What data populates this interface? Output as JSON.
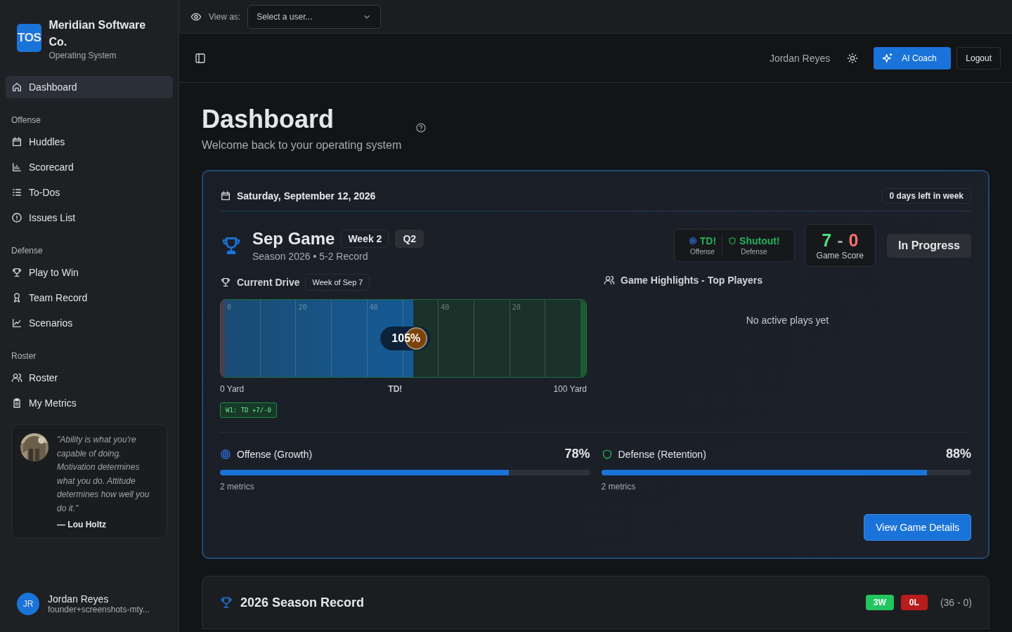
{
  "brand": {
    "logo": "TOS",
    "name": "Meridian Software Co.",
    "tagline": "Operating System"
  },
  "dashboard_item": {
    "label": "Dashboard",
    "selected": true
  },
  "nav_sections": [
    {
      "title": "Offense",
      "items": [
        {
          "label": "Huddles",
          "selected": false
        },
        {
          "label": "Scorecard",
          "selected": false
        },
        {
          "label": "To-Dos",
          "selected": false
        },
        {
          "label": "Issues List",
          "selected": false
        }
      ]
    },
    {
      "title": "Defense",
      "items": [
        {
          "label": "Play to Win",
          "selected": false
        },
        {
          "label": "Team Record",
          "selected": false
        },
        {
          "label": "Scenarios",
          "selected": false
        }
      ]
    },
    {
      "title": "Roster",
      "items": [
        {
          "label": "Roster",
          "selected": false
        },
        {
          "label": "My Metrics",
          "selected": false
        }
      ]
    }
  ],
  "quote": {
    "text": "\"Ability is what you're capable of doing. Motivation determines what you do. Attitude determines how well you do it.\"",
    "author": "— Lou Holtz"
  },
  "user": {
    "initials": "JR",
    "name": "Jordan Reyes",
    "email": "founder+screenshots-mty..."
  },
  "topbar": {
    "view_as_label": "View as:",
    "select_placeholder": "Select a user..."
  },
  "header": {
    "user_name": "Jordan Reyes",
    "ai_button": "AI Coach",
    "logout_button": "Logout"
  },
  "page": {
    "title": "Dashboard",
    "subtitle": "Welcome back to your operating system"
  },
  "game_card": {
    "date": "Saturday, September 12, 2026",
    "days_left": "0 days left in week",
    "title": "Sep Game",
    "week_badge": "Week 2",
    "quarter_badge": "Q2",
    "subtitle": "Season 2026 • 5-2 Record",
    "status_items": [
      {
        "kind": "offense",
        "value": "TD!",
        "label": "Offense"
      },
      {
        "kind": "defense",
        "value": "Shutout!",
        "label": "Defense"
      }
    ],
    "score": {
      "home": "7",
      "separator": "-",
      "away": "0",
      "label": "Game Score"
    },
    "status": "In Progress",
    "drive": {
      "title": "Current Drive",
      "week": "Week of Sep 7",
      "yard_markers": [
        "0",
        "20",
        "40",
        "40",
        "20"
      ],
      "level": 0.53,
      "percent": "105%",
      "start_label": "0 Yard",
      "mid_label": "TD!",
      "end_label": "100 Yard",
      "tag": "W1: TD +7/-0"
    },
    "highlights": {
      "title": "Game Highlights - Top Players",
      "empty": "No active plays yet"
    },
    "metrics": [
      {
        "kind": "offense",
        "label": "Offense (Growth)",
        "value": "78%",
        "level": 0.78,
        "sub": "2 metrics"
      },
      {
        "kind": "defense",
        "label": "Defense (Retention)",
        "value": "88%",
        "level": 0.88,
        "sub": "2 metrics"
      }
    ],
    "details_button": "View Game Details"
  },
  "season": {
    "title": "2026 Season Record",
    "wins": "3W",
    "losses": "0L",
    "totals": "(36 - 0)"
  }
}
